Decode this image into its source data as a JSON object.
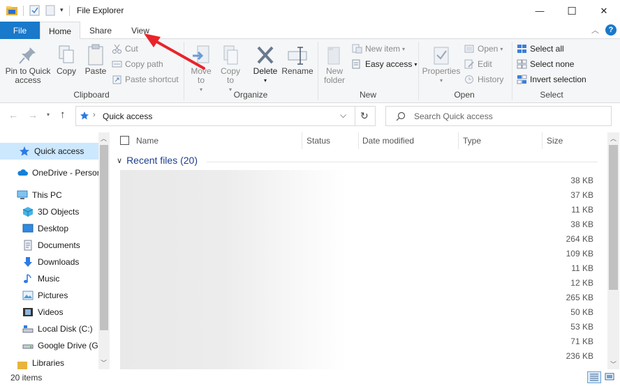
{
  "window": {
    "title": "File Explorer",
    "minimize_glyph": "—",
    "maximize_glyph": "☐",
    "close_glyph": "✕"
  },
  "ribbon_tabs": [
    "File",
    "Home",
    "Share",
    "View"
  ],
  "ribbon": {
    "clipboard": {
      "label": "Clipboard",
      "pin_to_quick_access": "Pin to Quick access",
      "copy": "Copy",
      "paste": "Paste",
      "cut": "Cut",
      "copy_path": "Copy path",
      "paste_shortcut": "Paste shortcut"
    },
    "organize": {
      "label": "Organize",
      "move_to": "Move to",
      "copy_to": "Copy to",
      "delete": "Delete",
      "rename": "Rename"
    },
    "new": {
      "label": "New",
      "new_folder": "New folder",
      "new_item": "New item",
      "easy_access": "Easy access"
    },
    "open": {
      "label": "Open",
      "properties": "Properties",
      "open": "Open",
      "edit": "Edit",
      "history": "History"
    },
    "select": {
      "label": "Select",
      "select_all": "Select all",
      "select_none": "Select none",
      "invert_selection": "Invert selection"
    }
  },
  "address": {
    "path": "Quick access",
    "search_placeholder": "Search Quick access"
  },
  "sidebar": {
    "items": [
      {
        "label": "Quick access",
        "icon": "star-icon",
        "selected": true
      },
      {
        "label": "OneDrive - Personal",
        "icon": "cloud-icon"
      },
      {
        "label": "This PC",
        "icon": "computer-icon"
      },
      {
        "label": "3D Objects",
        "icon": "cube-icon"
      },
      {
        "label": "Desktop",
        "icon": "desktop-icon"
      },
      {
        "label": "Documents",
        "icon": "document-icon"
      },
      {
        "label": "Downloads",
        "icon": "download-icon"
      },
      {
        "label": "Music",
        "icon": "music-icon"
      },
      {
        "label": "Pictures",
        "icon": "picture-icon"
      },
      {
        "label": "Videos",
        "icon": "video-icon"
      },
      {
        "label": "Local Disk (C:)",
        "icon": "disk-icon"
      },
      {
        "label": "Google Drive (G:)",
        "icon": "drive-icon"
      },
      {
        "label": "Libraries",
        "icon": "library-icon"
      }
    ]
  },
  "columns": [
    "Name",
    "Status",
    "Date modified",
    "Type",
    "Size"
  ],
  "group": {
    "title": "Recent files (20)"
  },
  "sizes": [
    "38 KB",
    "37 KB",
    "11 KB",
    "38 KB",
    "264 KB",
    "109 KB",
    "11 KB",
    "12 KB",
    "265 KB",
    "50 KB",
    "53 KB",
    "71 KB",
    "236 KB"
  ],
  "status": {
    "count": "20 items"
  },
  "colors": {
    "accent": "#1979ca",
    "selection": "#cce8ff",
    "annotation_arrow": "#e8242a"
  }
}
